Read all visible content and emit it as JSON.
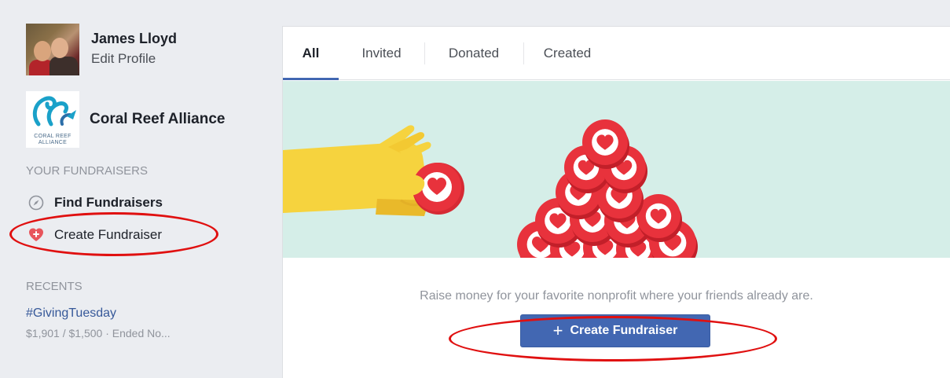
{
  "profile": {
    "name": "James Lloyd",
    "edit_label": "Edit Profile"
  },
  "organization": {
    "name": "Coral Reef Alliance",
    "logo_text_line1": "CORAL REEF",
    "logo_text_line2": "ALLIANCE"
  },
  "sidebar": {
    "fundraisers_heading": "YOUR FUNDRAISERS",
    "find_label": "Find Fundraisers",
    "create_label": "Create Fundraiser",
    "recents_heading": "RECENTS",
    "recent_item": {
      "title": "#GivingTuesday",
      "subtitle": "$1,901 / $1,500 · Ended No..."
    }
  },
  "tabs": [
    {
      "label": "All",
      "active": true
    },
    {
      "label": "Invited",
      "active": false
    },
    {
      "label": "Donated",
      "active": false
    },
    {
      "label": "Created",
      "active": false
    }
  ],
  "main": {
    "prompt": "Raise money for your favorite nonprofit where your friends already are.",
    "cta_icon": "+",
    "cta_label": "Create Fundraiser"
  },
  "colors": {
    "accent": "#4267b2",
    "banner_bg": "#d5eee8",
    "heart_red": "#e8323c",
    "annotation_red": "#e01010"
  },
  "icons": {
    "find": "compass-icon",
    "create": "heart-plus-icon"
  }
}
